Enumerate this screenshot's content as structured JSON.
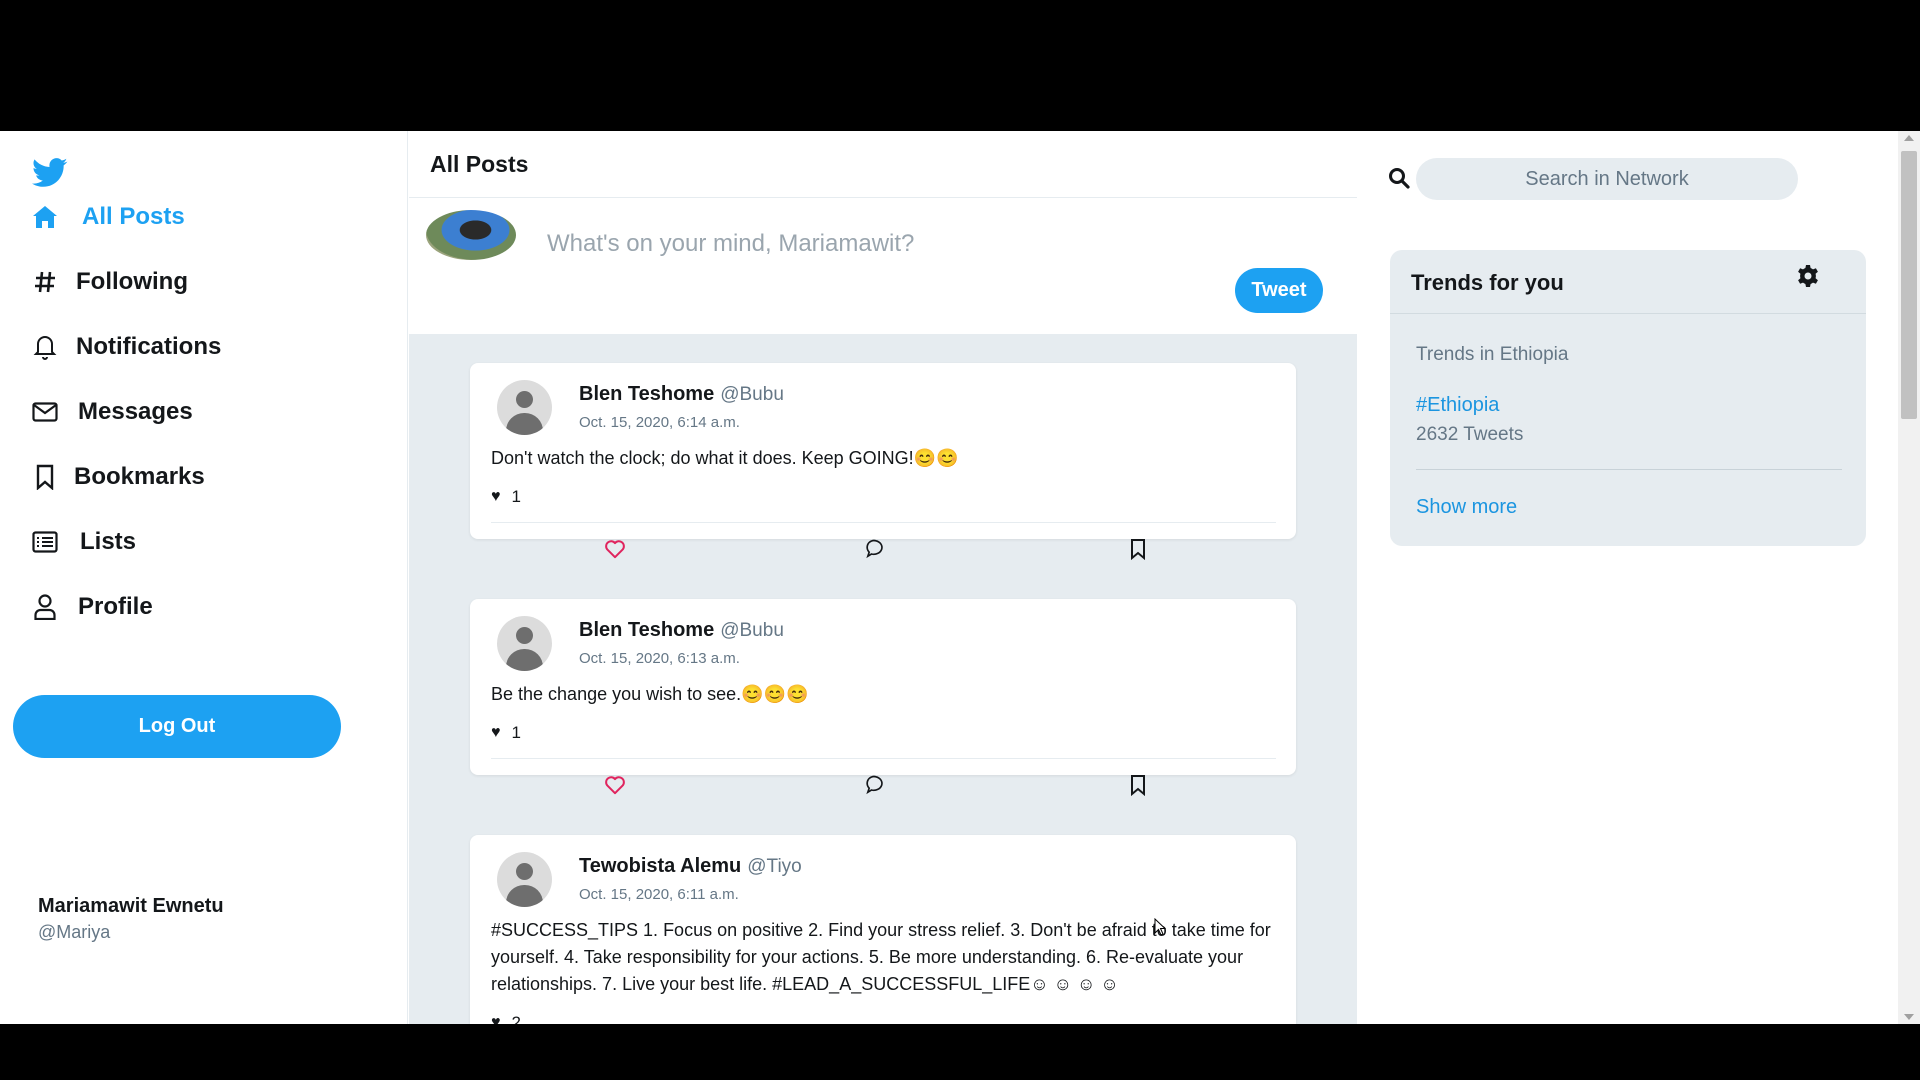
{
  "sidebar": {
    "logo_icon": "twitter-bird-icon",
    "nav": [
      {
        "label": "All Posts",
        "icon": "home-icon",
        "active": true
      },
      {
        "label": "Following",
        "icon": "hash-icon"
      },
      {
        "label": "Notifications",
        "icon": "bell-icon"
      },
      {
        "label": "Messages",
        "icon": "envelope-icon"
      },
      {
        "label": "Bookmarks",
        "icon": "bookmark-icon"
      },
      {
        "label": "Lists",
        "icon": "list-icon"
      },
      {
        "label": "Profile",
        "icon": "user-icon"
      }
    ],
    "logout_label": "Log Out",
    "user": {
      "name": "Mariamawit Ewnetu",
      "handle": "@Mariya"
    }
  },
  "main": {
    "title": "All Posts",
    "composer": {
      "placeholder": "What's on your mind, Mariamawit?",
      "tweet_label": "Tweet"
    },
    "posts": [
      {
        "name": "Blen Teshome",
        "handle": "@Bubu",
        "date": "Oct. 15, 2020, 6:14 a.m.",
        "text": "Don't watch the clock; do what it does. Keep GOING!😊😊",
        "likes": "1"
      },
      {
        "name": "Blen Teshome",
        "handle": "@Bubu",
        "date": "Oct. 15, 2020, 6:13 a.m.",
        "text": "Be the change you wish to see.😊😊😊",
        "likes": "1"
      },
      {
        "name": "Tewobista Alemu",
        "handle": "@Tiyo",
        "date": "Oct. 15, 2020, 6:11 a.m.",
        "text": "#SUCCESS_TIPS 1. Focus on positive 2. Find your stress relief. 3. Don't be afraid to take time for yourself. 4. Take responsibility for your actions. 5. Be more understanding. 6. Re-evaluate your relationships. 7. Live your best life. #LEAD_A_SUCCESSFUL_LIFE☺ ☺ ☺ ☺",
        "likes": "2"
      }
    ]
  },
  "right": {
    "search_placeholder": "Search in Network",
    "trends": {
      "title": "Trends for you",
      "subtitle": "Trends in Ethiopia",
      "tag": "#Ethiopia",
      "count": "2632 Tweets",
      "show_more": "Show more"
    }
  },
  "colors": {
    "accent": "#1da1f2",
    "like": "#e0245e",
    "panel": "#e6ecf0"
  }
}
